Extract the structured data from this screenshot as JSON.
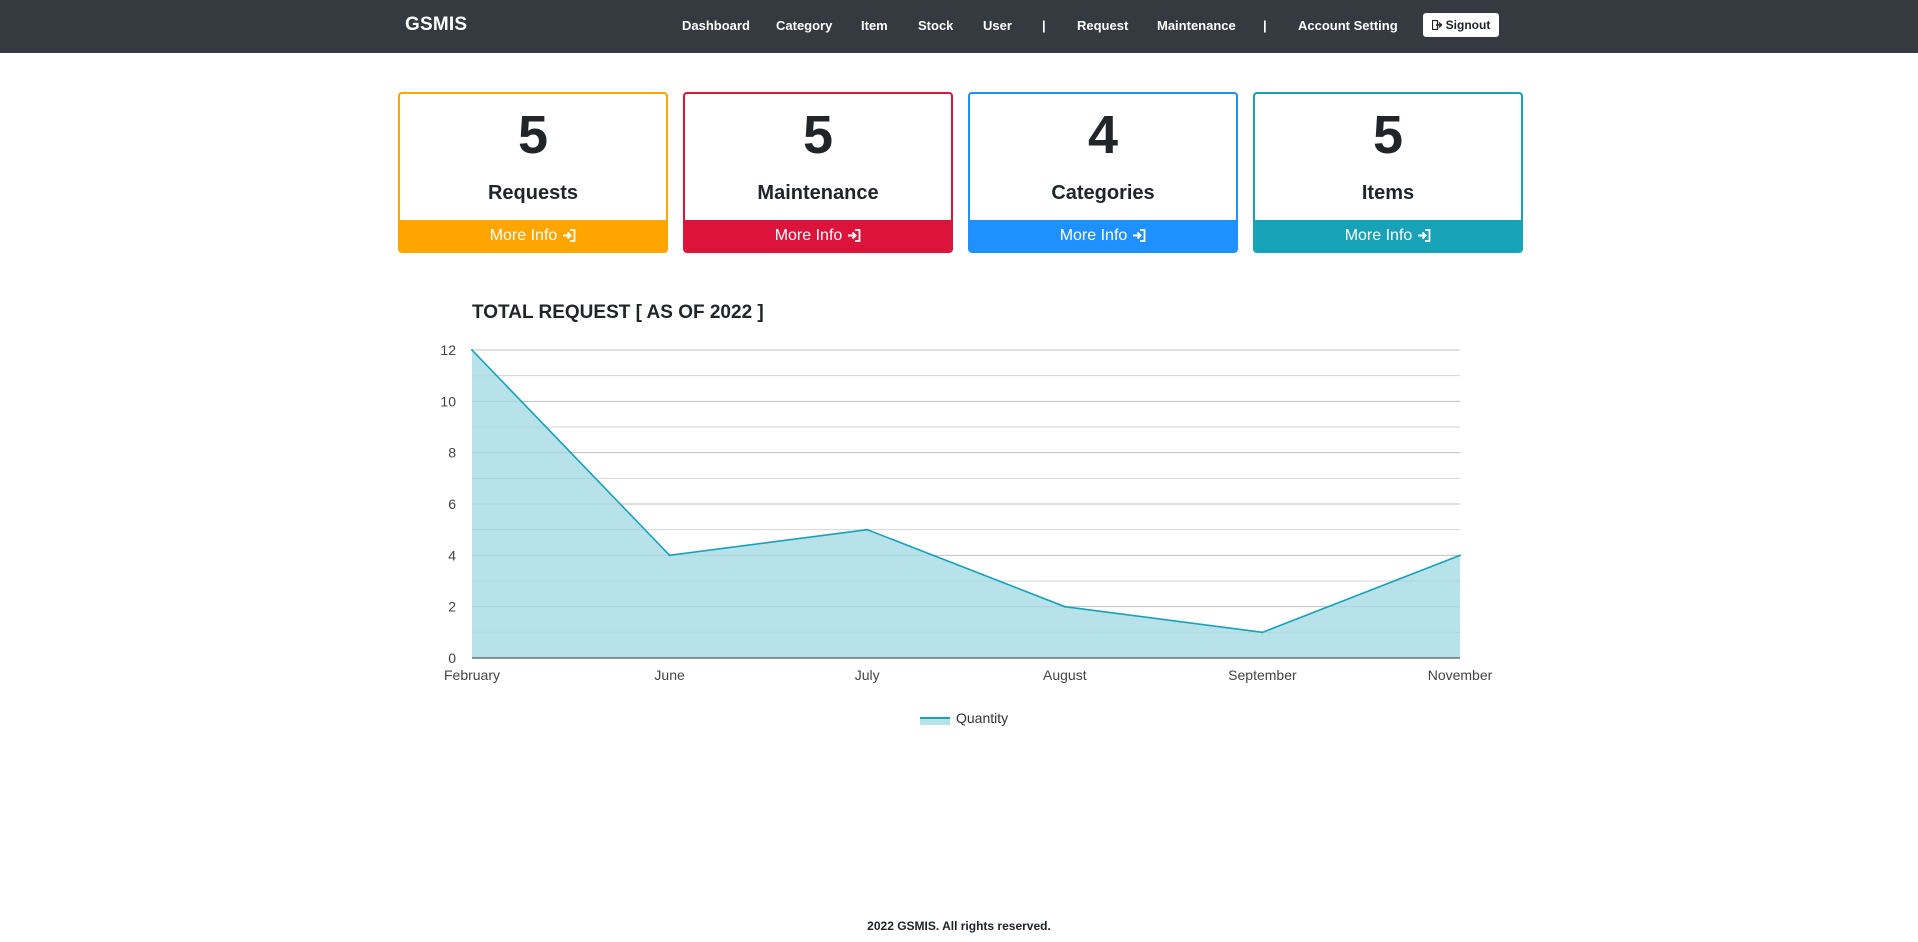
{
  "navbar": {
    "brand": "GSMIS",
    "links": [
      "Dashboard",
      "Category",
      "Item",
      "Stock",
      "User",
      "Request",
      "Maintenance",
      "Account Setting"
    ],
    "separator": "|",
    "signout_label": "Signout"
  },
  "cards": [
    {
      "count": "5",
      "label": "Requests",
      "more": "More Info",
      "color": "#ffa500"
    },
    {
      "count": "5",
      "label": "Maintenance",
      "more": "More Info",
      "color": "#dc143c"
    },
    {
      "count": "4",
      "label": "Categories",
      "more": "More Info",
      "color": "#1e90ff"
    },
    {
      "count": "5",
      "label": "Items",
      "more": "More Info",
      "color": "#17a2b8"
    }
  ],
  "chart_data": {
    "type": "area",
    "title": "TOTAL REQUEST [ AS OF 2022 ]",
    "categories": [
      "February",
      "June",
      "July",
      "August",
      "September",
      "November"
    ],
    "series": [
      {
        "name": "Quantity",
        "values": [
          12,
          4,
          5,
          2,
          1,
          4
        ]
      }
    ],
    "ylim": [
      0,
      12
    ],
    "yticks": [
      0,
      2,
      4,
      6,
      8,
      10,
      12
    ],
    "grid": true,
    "legend": "bottom",
    "line_color": "#17a2b8",
    "fill_color": "#b8e2ea"
  },
  "footer": {
    "text": "2022 GSMIS. All rights reserved."
  }
}
